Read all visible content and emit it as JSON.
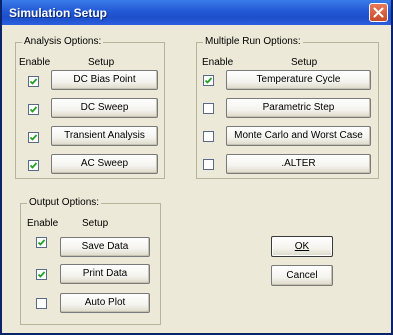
{
  "window": {
    "title": "Simulation Setup"
  },
  "analysis": {
    "group_label": "Analysis Options:",
    "enable_header": "Enable",
    "setup_header": "Setup",
    "items": [
      {
        "label": "DC Bias Point",
        "checked": true
      },
      {
        "label": "DC Sweep",
        "checked": true
      },
      {
        "label": "Transient Analysis",
        "checked": true
      },
      {
        "label": "AC Sweep",
        "checked": true
      }
    ]
  },
  "multirun": {
    "group_label": "Multiple Run Options:",
    "enable_header": "Enable",
    "setup_header": "Setup",
    "items": [
      {
        "label": "Temperature Cycle",
        "checked": true
      },
      {
        "label": "Parametric Step",
        "checked": false
      },
      {
        "label": "Monte Carlo and Worst Case",
        "checked": false
      },
      {
        "label": ".ALTER",
        "checked": false
      }
    ]
  },
  "output": {
    "group_label": "Output Options:",
    "enable_header": "Enable",
    "setup_header": "Setup",
    "items": [
      {
        "label": "Save Data",
        "checked": true
      },
      {
        "label": "Print Data",
        "checked": true
      },
      {
        "label": "Auto Plot",
        "checked": false
      }
    ]
  },
  "actions": {
    "ok_label": "OK",
    "cancel_label": "Cancel"
  }
}
